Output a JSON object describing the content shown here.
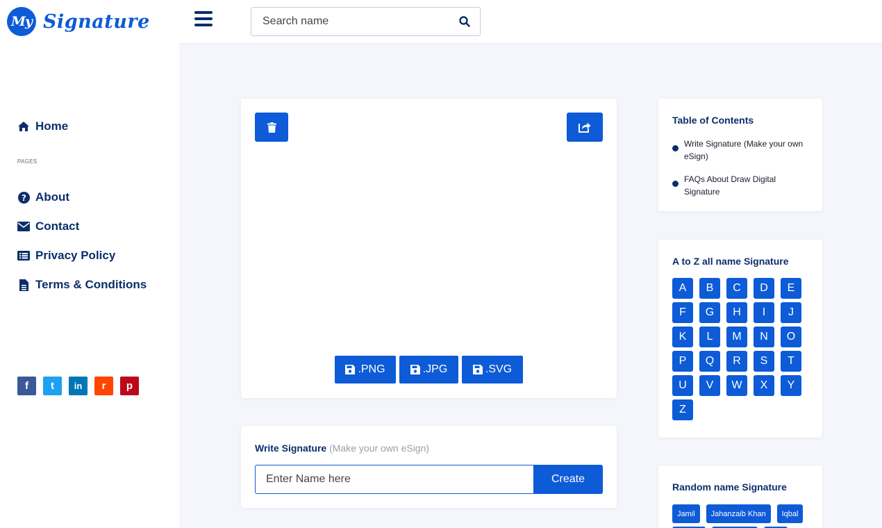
{
  "header": {
    "logo_mark": "My",
    "logo_text": "Signature",
    "search_placeholder": "Search name"
  },
  "sidebar": {
    "home": "Home",
    "section_label": "PAGES",
    "items": [
      "About",
      "Contact",
      "Privacy Policy",
      "Terms & Conditions"
    ],
    "socials": [
      {
        "name": "facebook",
        "glyph": "f",
        "color": "#3b5998"
      },
      {
        "name": "twitter",
        "glyph": "t",
        "color": "#1da1f2"
      },
      {
        "name": "linkedin",
        "glyph": "in",
        "color": "#0077b5"
      },
      {
        "name": "reddit",
        "glyph": "r",
        "color": "#ff4500"
      },
      {
        "name": "pinterest",
        "glyph": "p",
        "color": "#bd081c"
      }
    ]
  },
  "canvas": {
    "downloads": [
      ".PNG",
      ".JPG",
      ".SVG"
    ]
  },
  "write": {
    "title": "Write Signature",
    "subtitle": "(Make your own eSign)",
    "input_placeholder": "Enter Name here",
    "create_label": "Create"
  },
  "toc": {
    "title": "Table of Contents",
    "items": [
      "Write Signature (Make your own eSign)",
      "FAQs About Draw Digital Signature"
    ]
  },
  "az": {
    "title": "A to Z all name Signature",
    "letters": [
      "A",
      "B",
      "C",
      "D",
      "E",
      "F",
      "G",
      "H",
      "I",
      "J",
      "K",
      "L",
      "M",
      "N",
      "O",
      "P",
      "Q",
      "R",
      "S",
      "T",
      "U",
      "V",
      "W",
      "X",
      "Y",
      "Z"
    ]
  },
  "random": {
    "title": "Random name Signature",
    "names": [
      "Jamil",
      "Jahanzaib Khan",
      "Iqbal"
    ]
  },
  "colors": {
    "primary": "#0d5bd7",
    "navy": "#0b2e6b",
    "background": "#f4f6fc"
  }
}
